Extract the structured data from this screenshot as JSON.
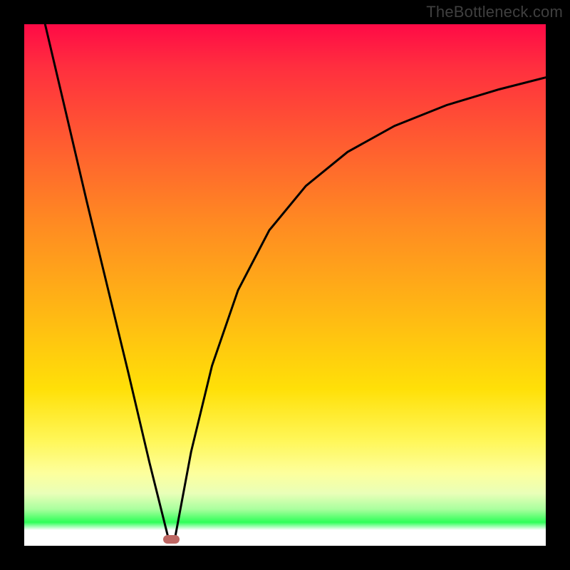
{
  "watermark": "TheBottleneck.com",
  "colors": {
    "frame": "#000000",
    "curve": "#000000",
    "marker": "#be6663",
    "gradient_stops": [
      {
        "pos": 0.0,
        "color": "#ff0a46"
      },
      {
        "pos": 0.08,
        "color": "#ff2e3f"
      },
      {
        "pos": 0.22,
        "color": "#ff5a31"
      },
      {
        "pos": 0.38,
        "color": "#ff8a22"
      },
      {
        "pos": 0.55,
        "color": "#ffb714"
      },
      {
        "pos": 0.7,
        "color": "#ffe008"
      },
      {
        "pos": 0.8,
        "color": "#fff75a"
      },
      {
        "pos": 0.86,
        "color": "#fdff9c"
      },
      {
        "pos": 0.9,
        "color": "#e9ffb8"
      },
      {
        "pos": 0.93,
        "color": "#a9ff9e"
      },
      {
        "pos": 0.955,
        "color": "#2dff57"
      },
      {
        "pos": 0.97,
        "color": "#ffffff"
      },
      {
        "pos": 1.0,
        "color": "#ffffff"
      }
    ]
  },
  "chart_data": {
    "type": "line",
    "title": "",
    "xlabel": "",
    "ylabel": "",
    "xlim": [
      0,
      1
    ],
    "ylim": [
      0,
      1
    ],
    "note": "Screenshot shows no visible axes/ticks; values are normalized 0–1 where y=1 is the top of the plot and y=0 is the bottom. Curve descends steeply from top-left, reaches a sharp minimum near x≈0.28, then rises with diminishing slope toward the upper-right.",
    "series": [
      {
        "name": "left-branch",
        "x": [
          0.04,
          0.08,
          0.12,
          0.16,
          0.2,
          0.24,
          0.275
        ],
        "y": [
          1.0,
          0.83,
          0.66,
          0.495,
          0.33,
          0.16,
          0.02
        ]
      },
      {
        "name": "right-branch",
        "x": [
          0.29,
          0.32,
          0.36,
          0.41,
          0.47,
          0.54,
          0.62,
          0.71,
          0.81,
          0.91,
          1.0
        ],
        "y": [
          0.02,
          0.18,
          0.345,
          0.49,
          0.605,
          0.69,
          0.755,
          0.805,
          0.845,
          0.875,
          0.898
        ]
      }
    ],
    "marker": {
      "x": 0.282,
      "y": 0.012,
      "width_frac": 0.032,
      "height_frac": 0.016
    }
  }
}
